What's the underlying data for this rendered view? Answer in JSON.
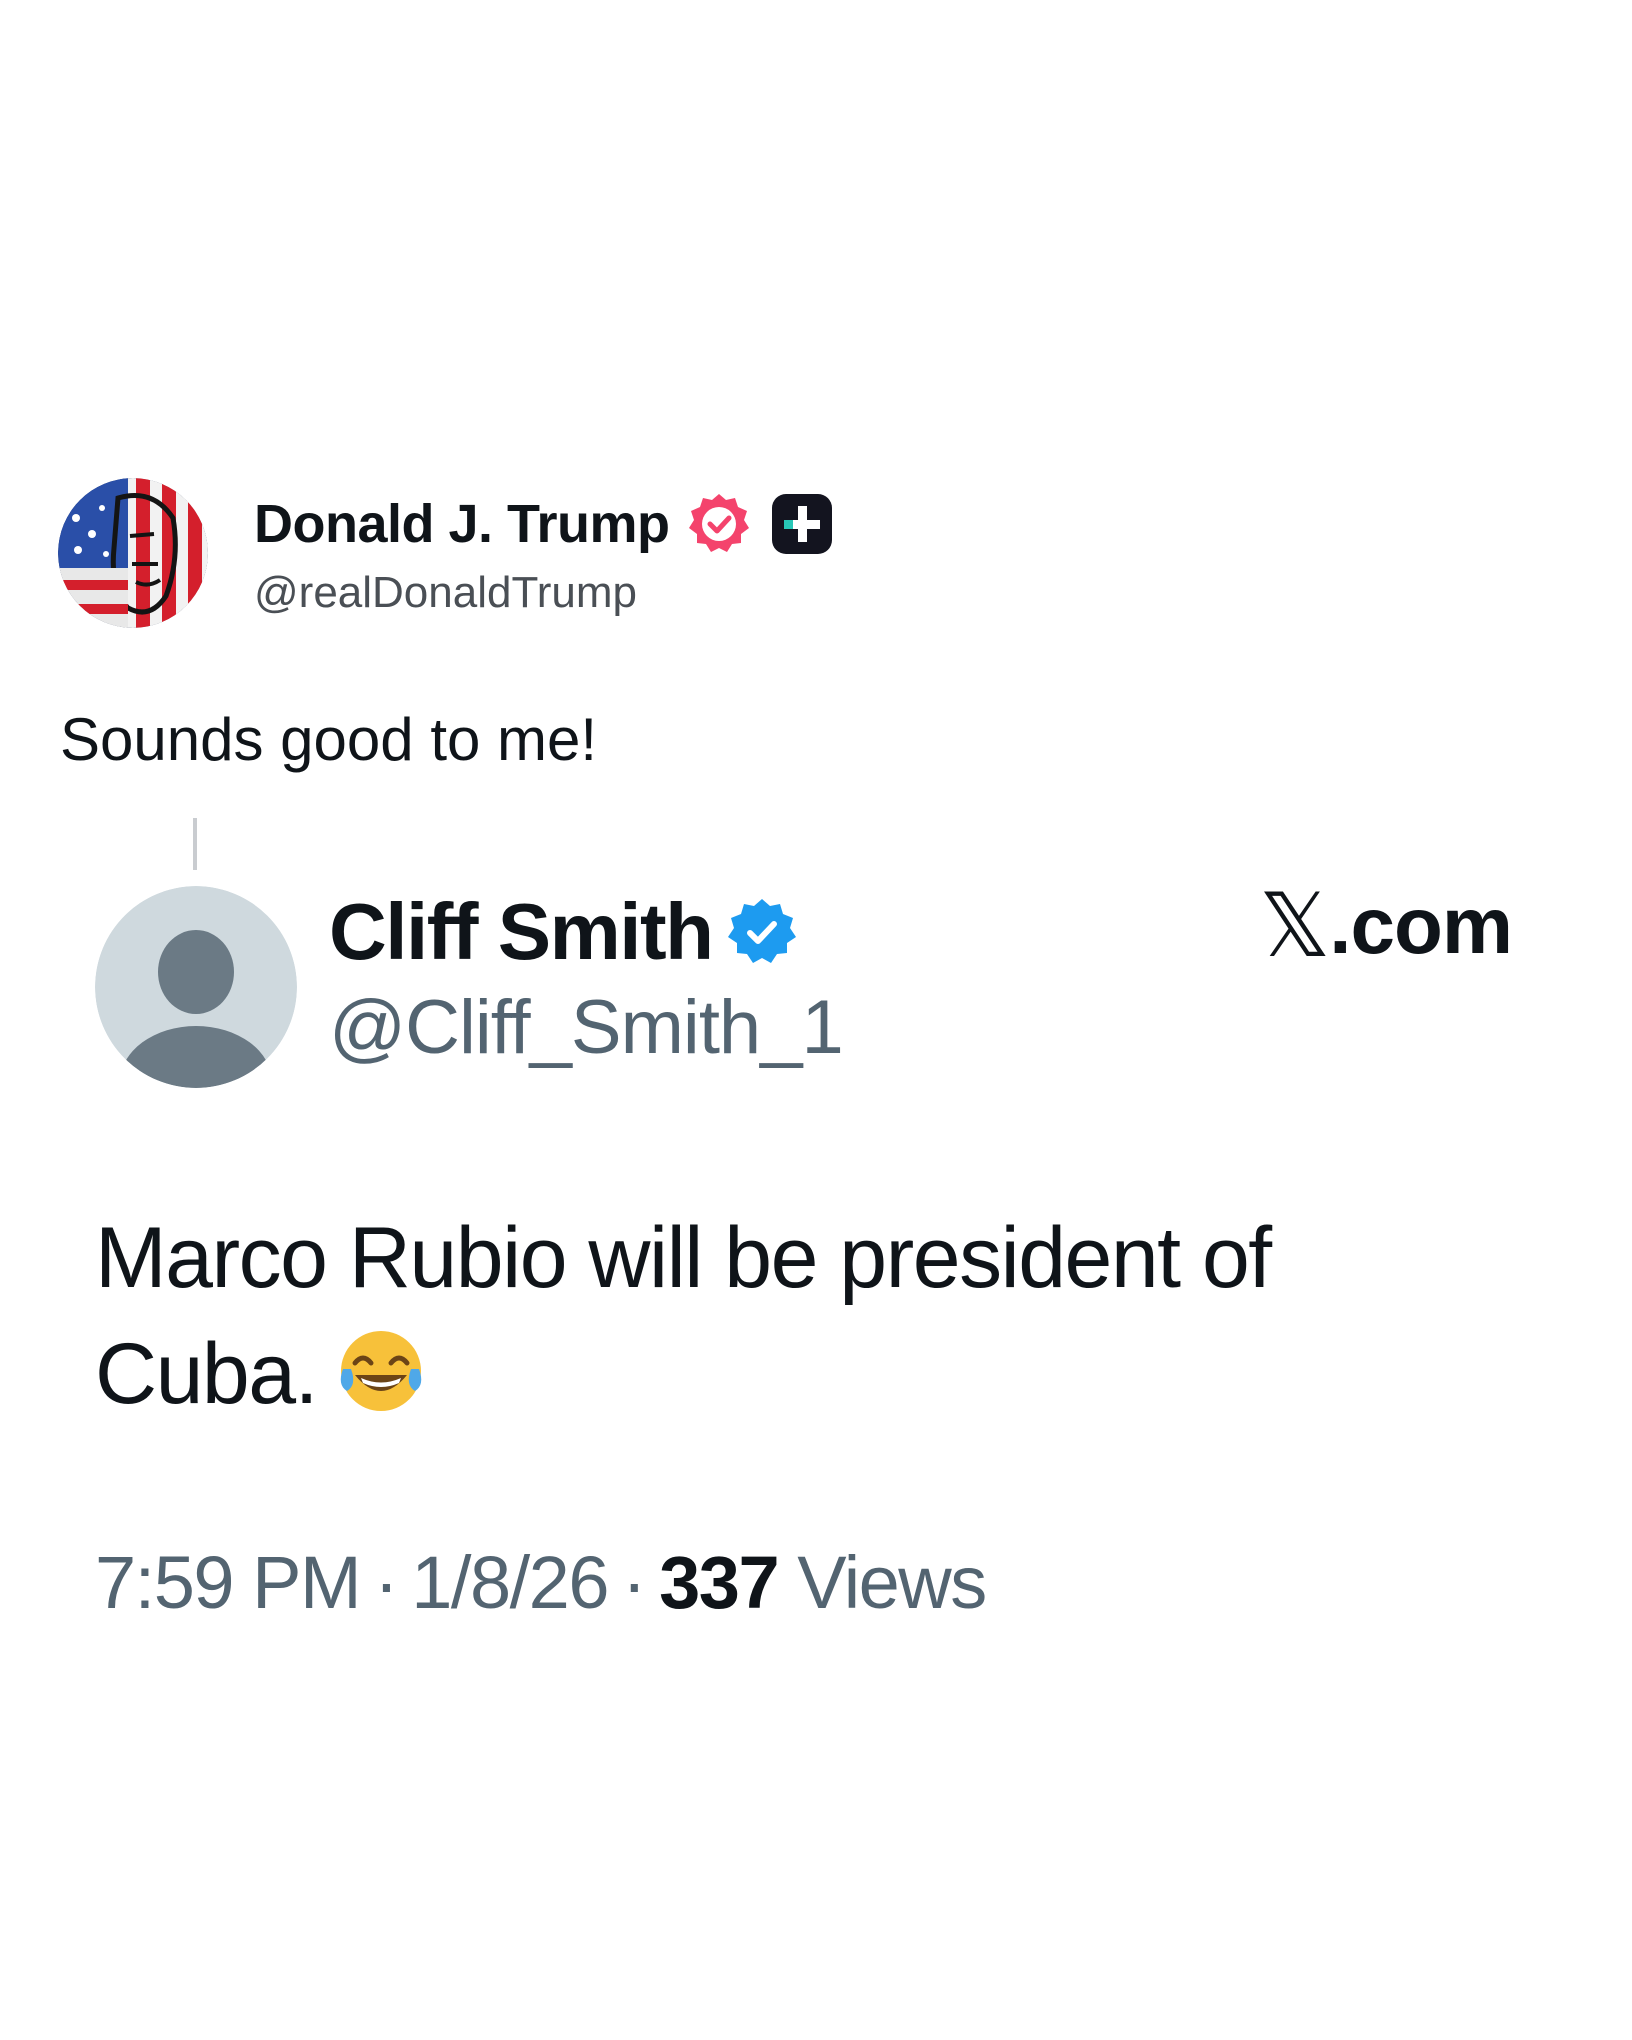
{
  "post": {
    "author": {
      "display_name": "Donald J. Trump",
      "handle": "@realDonaldTrump",
      "verified_badge_icon": "verified-badge-icon",
      "verified_badge_color": "#f4436c",
      "plus_badge_icon": "plus-badge-icon",
      "avatar_icon": "american-flag-portrait-avatar"
    },
    "text": "Sounds good to me!"
  },
  "quoted": {
    "author": {
      "display_name": "Cliff Smith",
      "handle": "@Cliff_Smith_1",
      "verified_badge_icon": "verified-badge-icon",
      "verified_badge_color": "#1d9bf0",
      "avatar_icon": "default-profile-avatar"
    },
    "source": {
      "logo_icon": "x-logo-icon",
      "logo_text": "𝕏",
      "suffix": ".com"
    },
    "text": "Marco Rubio will be president of Cuba.",
    "emoji_icon": "face-with-tears-of-joy-icon",
    "time": "7:59 PM",
    "separator": "·",
    "date": "1/8/26",
    "views_count": "337",
    "views_label": "Views"
  },
  "colors": {
    "text_primary": "#0f1419",
    "text_secondary": "#536471",
    "background": "#ffffff"
  }
}
